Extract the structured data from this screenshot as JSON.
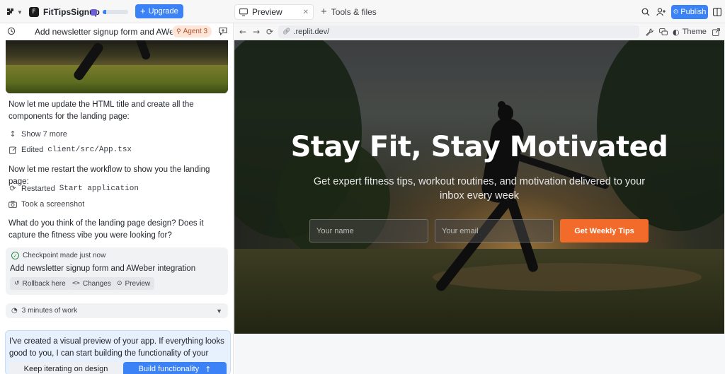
{
  "topbar": {
    "project_name": "FitTipsSignup",
    "project_initial": "F",
    "upgrade_label": "Upgrade",
    "storage_used": 0.15,
    "tabs": [
      {
        "label": "Preview",
        "active": true
      }
    ],
    "tools_label": "Tools & files",
    "publish_label": "Publish"
  },
  "chat": {
    "title": "Add newsletter signup form and AWeber ...",
    "agent_badge": "Agent 3",
    "messages": [
      {
        "text": "Now let me update the HTML title and create all the components for the landing page:"
      },
      {
        "text": "Now let me restart the workflow to show you the landing page:"
      },
      {
        "text": "What do you think of the landing page design? Does it capture the fitness vibe you were looking for?"
      }
    ],
    "actions": {
      "show_more": "Show 7 more",
      "edited_prefix": "Edited",
      "edited_file": "client/src/App.tsx",
      "restarted_prefix": "Restarted",
      "restarted_target": "Start application",
      "screenshot": "Took a screenshot"
    },
    "checkpoint": {
      "status": "Checkpoint made just now",
      "title": "Add newsletter signup form and AWeber integration",
      "rollback": "Rollback here",
      "changes": "Changes",
      "preview": "Preview"
    },
    "work_time": "3 minutes of work",
    "suggestion": {
      "text": "I've created a visual preview of your app. If everything looks good to you, I can start building the functionality of your app.",
      "iterate_label": "Keep iterating on design",
      "build_label": "Build functionality"
    }
  },
  "preview": {
    "url": ".replit.dev/",
    "theme_label": "Theme",
    "hero": {
      "title": "Stay Fit, Stay Motivated",
      "subtitle": "Get expert fitness tips, workout routines, and motivation delivered to your inbox every week",
      "name_placeholder": "Your name",
      "email_placeholder": "Your email",
      "cta_label": "Get Weekly Tips"
    }
  },
  "colors": {
    "accent": "#3b82f6",
    "cta": "#f26b2a",
    "agent_badge_bg": "#fde5d8",
    "suggestion_bg": "#e7f0fd"
  }
}
